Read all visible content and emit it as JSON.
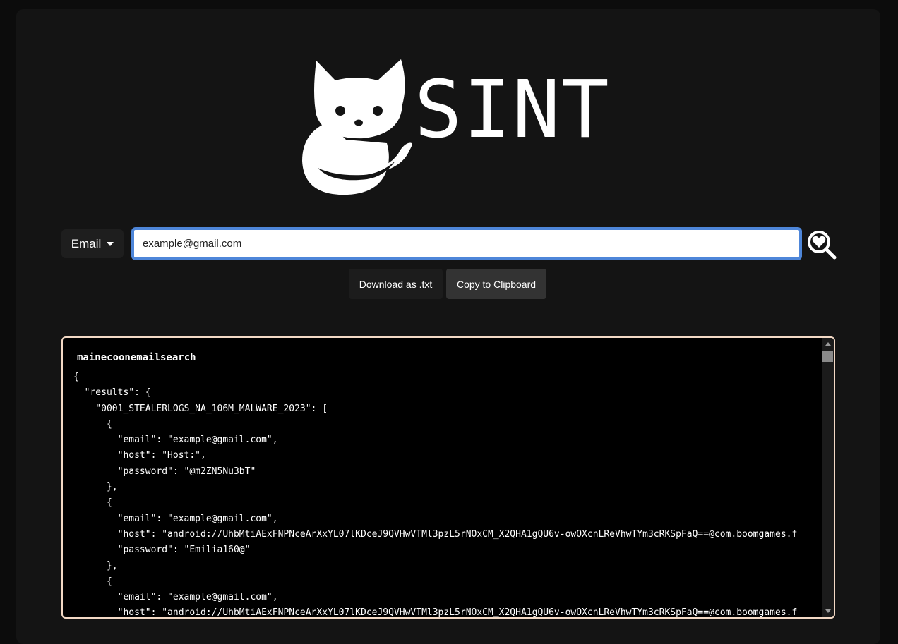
{
  "logo": {
    "text": "SINT",
    "icon": "cat-icon"
  },
  "search": {
    "type_selected": "Email",
    "value": "example@gmail.com",
    "button_icon": "heart-magnifier-icon"
  },
  "actions": {
    "download_label": "Download as .txt",
    "copy_label": "Copy to Clipboard"
  },
  "results": {
    "title": "mainecoonemailsearch",
    "lines": [
      "{",
      "  \"results\": {",
      "    \"0001_STEALERLOGS_NA_106M_MALWARE_2023\": [",
      "      {",
      "        \"email\": \"example@gmail.com\",",
      "        \"host\": \"Host:\",",
      "        \"password\": \"@m2ZN5Nu3bT\"",
      "      },",
      "      {",
      "        \"email\": \"example@gmail.com\",",
      "        \"host\": \"android://UhbMtiAExFNPNceArXxYL07lKDceJ9QVHwVTMl3pzL5rNOxCM_X2QHA1gQU6v-owOXcnLReVhwTYm3cRKSpFaQ==@com.boomgames.f",
      "        \"password\": \"Emilia160@\"",
      "      },",
      "      {",
      "        \"email\": \"example@gmail.com\",",
      "        \"host\": \"android://UhbMtiAExFNPNceArXxYL07lKDceJ9QVHwVTMl3pzL5rNOxCM_X2QHA1gQU6v-owOXcnLReVhwTYm3cRKSpFaQ==@com.boomgames.f"
    ]
  }
}
